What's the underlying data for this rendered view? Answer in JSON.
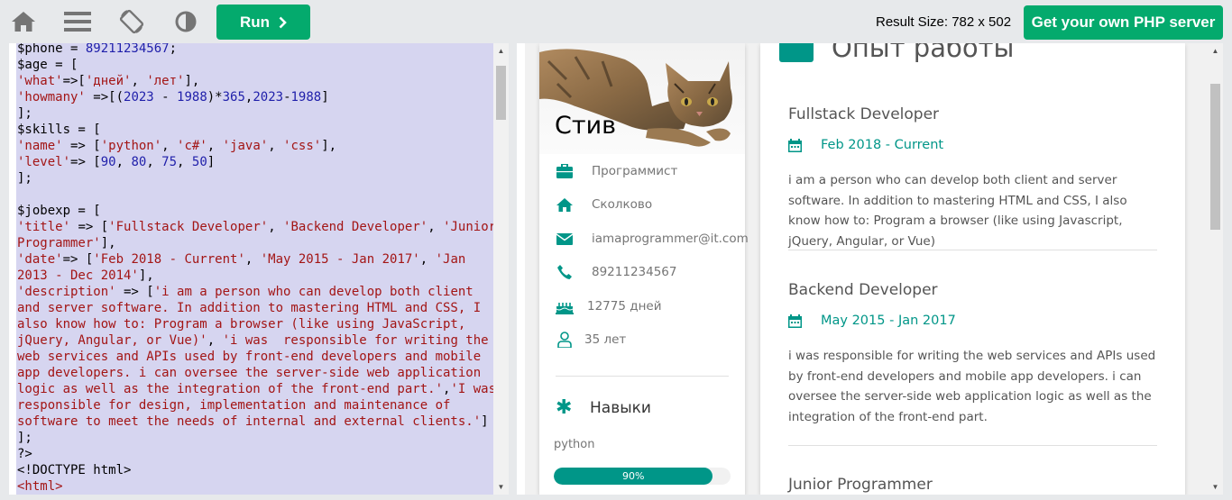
{
  "toolbar": {
    "run_label": "Run",
    "result_size": "Result Size: 782 x 502",
    "own_server_label": "Get your own PHP server",
    "icons": [
      "home-icon",
      "menu-icon",
      "rotate-icon",
      "contrast-icon",
      "chevron-right-icon"
    ]
  },
  "code": {
    "lines": [
      [
        {
          "t": "$phone = ",
          "c": ""
        },
        {
          "t": "89211234567",
          "c": "n"
        },
        {
          "t": ";",
          "c": ""
        }
      ],
      [
        {
          "t": "$age = [",
          "c": ""
        }
      ],
      [
        {
          "t": "'what'",
          "c": "s"
        },
        {
          "t": "=>[",
          "c": ""
        },
        {
          "t": "'дней'",
          "c": "s"
        },
        {
          "t": ", ",
          "c": ""
        },
        {
          "t": "'лет'",
          "c": "s"
        },
        {
          "t": "],",
          "c": ""
        }
      ],
      [
        {
          "t": "'howmany'",
          "c": "s"
        },
        {
          "t": " =>[(",
          "c": ""
        },
        {
          "t": "2023",
          "c": "n"
        },
        {
          "t": " - ",
          "c": ""
        },
        {
          "t": "1988",
          "c": "n"
        },
        {
          "t": ")*",
          "c": ""
        },
        {
          "t": "365",
          "c": "n"
        },
        {
          "t": ",",
          "c": ""
        },
        {
          "t": "2023",
          "c": "n"
        },
        {
          "t": "-",
          "c": ""
        },
        {
          "t": "1988",
          "c": "n"
        },
        {
          "t": "]",
          "c": ""
        }
      ],
      [
        {
          "t": "];",
          "c": ""
        }
      ],
      [
        {
          "t": "$skills = [",
          "c": ""
        }
      ],
      [
        {
          "t": "'name'",
          "c": "s"
        },
        {
          "t": " => [",
          "c": ""
        },
        {
          "t": "'python'",
          "c": "s"
        },
        {
          "t": ", ",
          "c": ""
        },
        {
          "t": "'c#'",
          "c": "s"
        },
        {
          "t": ", ",
          "c": ""
        },
        {
          "t": "'java'",
          "c": "s"
        },
        {
          "t": ", ",
          "c": ""
        },
        {
          "t": "'css'",
          "c": "s"
        },
        {
          "t": "],",
          "c": ""
        }
      ],
      [
        {
          "t": "'level'",
          "c": "s"
        },
        {
          "t": "=> [",
          "c": ""
        },
        {
          "t": "90",
          "c": "n"
        },
        {
          "t": ", ",
          "c": ""
        },
        {
          "t": "80",
          "c": "n"
        },
        {
          "t": ", ",
          "c": ""
        },
        {
          "t": "75",
          "c": "n"
        },
        {
          "t": ", ",
          "c": ""
        },
        {
          "t": "50",
          "c": "n"
        },
        {
          "t": "]",
          "c": ""
        }
      ],
      [
        {
          "t": "];",
          "c": ""
        }
      ],
      [
        {
          "t": "",
          "c": ""
        }
      ],
      [
        {
          "t": "$jobexp = [",
          "c": ""
        }
      ],
      [
        {
          "t": "'title'",
          "c": "s"
        },
        {
          "t": " => [",
          "c": ""
        },
        {
          "t": "'Fullstack Developer'",
          "c": "s"
        },
        {
          "t": ", ",
          "c": ""
        },
        {
          "t": "'Backend Developer'",
          "c": "s"
        },
        {
          "t": ", ",
          "c": ""
        },
        {
          "t": "'Junior",
          "c": "s"
        }
      ],
      [
        {
          "t": "Programmer'",
          "c": "s"
        },
        {
          "t": "],",
          "c": ""
        }
      ],
      [
        {
          "t": "'date'",
          "c": "s"
        },
        {
          "t": "=> [",
          "c": ""
        },
        {
          "t": "'Feb 2018 - Current'",
          "c": "s"
        },
        {
          "t": ", ",
          "c": ""
        },
        {
          "t": "'May 2015 - Jan 2017'",
          "c": "s"
        },
        {
          "t": ", ",
          "c": ""
        },
        {
          "t": "'Jan",
          "c": "s"
        }
      ],
      [
        {
          "t": "2013 - Dec 2014'",
          "c": "s"
        },
        {
          "t": "],",
          "c": ""
        }
      ],
      [
        {
          "t": "'description'",
          "c": "s"
        },
        {
          "t": " => [",
          "c": ""
        },
        {
          "t": "'i am a person who can develop both client",
          "c": "s"
        }
      ],
      [
        {
          "t": "and server software. In addition to mastering HTML and CSS, I",
          "c": "s"
        }
      ],
      [
        {
          "t": "also know how to: Program a browser (like using JavaScript,",
          "c": "s"
        }
      ],
      [
        {
          "t": "jQuery, Angular, or Vue)'",
          "c": "s"
        },
        {
          "t": ", ",
          "c": ""
        },
        {
          "t": "'i was  responsible for writing the",
          "c": "s"
        }
      ],
      [
        {
          "t": "web services and APIs used by front-end developers and mobile",
          "c": "s"
        }
      ],
      [
        {
          "t": "app developers. i can oversee the server-side web application",
          "c": "s"
        }
      ],
      [
        {
          "t": "logic as well as the integration of the front-end part.'",
          "c": "s"
        },
        {
          "t": ",",
          "c": ""
        },
        {
          "t": "'I was",
          "c": "s"
        }
      ],
      [
        {
          "t": "responsible for design, implementation and maintenance of",
          "c": "s"
        }
      ],
      [
        {
          "t": "software to meet the needs of internal and external clients.'",
          "c": "s"
        },
        {
          "t": "]",
          "c": ""
        }
      ],
      [
        {
          "t": "];",
          "c": ""
        }
      ],
      [
        {
          "t": "?>",
          "c": ""
        }
      ],
      [
        {
          "t": "<!DOCTYPE html>",
          "c": ""
        }
      ],
      [
        {
          "t": "<html>",
          "c": "t"
        }
      ]
    ]
  },
  "profile": {
    "name": "Стив",
    "info": [
      {
        "icon": "briefcase-icon",
        "text": "Программист"
      },
      {
        "icon": "home-icon",
        "text": "Сколково"
      },
      {
        "icon": "envelope-icon",
        "text": "iamaprogrammer@it.com"
      },
      {
        "icon": "phone-icon",
        "text": "89211234567"
      },
      {
        "icon": "birthday-cake-icon",
        "text": "12775 дней"
      },
      {
        "icon": "user-icon",
        "text": "35 лет"
      }
    ],
    "skills_heading": "Навыки",
    "skill_name": "python",
    "skill_level_pct": 90,
    "skill_level_label": "90%",
    "accent": "#009688"
  },
  "experience": {
    "heading": "Опыт работы",
    "jobs": [
      {
        "title": "Fullstack Developer",
        "date": "Feb 2018 - Current",
        "desc": "i am a person who can develop both client and server software. In addition to mastering HTML and CSS, I also know how to: Program a browser (like using Javascript, jQuery, Angular, or Vue)"
      },
      {
        "title": "Backend Developer",
        "date": "May 2015 - Jan 2017",
        "desc": "i was responsible for writing the web services and APIs used by front-end developers and mobile app developers. i can oversee the server-side web application logic as well as the integration of the front-end part."
      },
      {
        "title": "Junior Programmer",
        "date": "",
        "desc": ""
      }
    ]
  }
}
